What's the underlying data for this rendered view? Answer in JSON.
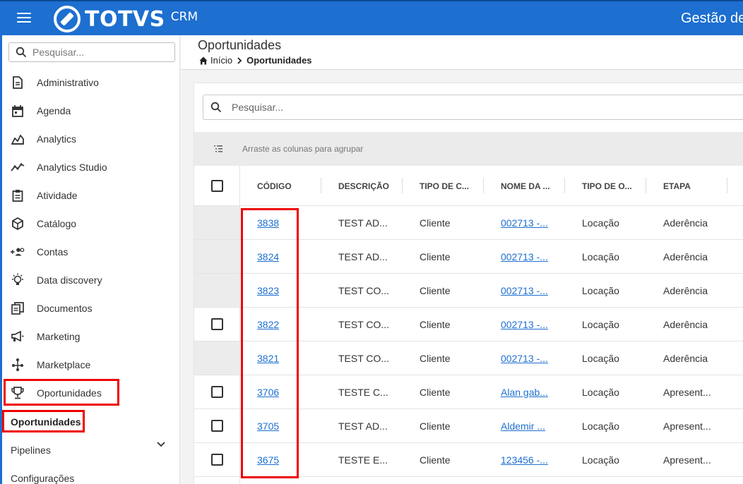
{
  "topbar": {
    "brand": "TOTVS",
    "brand_sub": "CRM",
    "title": "Gestão de"
  },
  "sidebar": {
    "search_placeholder": "Pesquisar...",
    "items": [
      {
        "label": "Administrativo",
        "icon": "document-icon"
      },
      {
        "label": "Agenda",
        "icon": "calendar-icon"
      },
      {
        "label": "Analytics",
        "icon": "area-chart-icon"
      },
      {
        "label": "Analytics Studio",
        "icon": "trend-line-icon"
      },
      {
        "label": "Atividade",
        "icon": "clipboard-icon"
      },
      {
        "label": "Catálogo",
        "icon": "cube-icon"
      },
      {
        "label": "Contas",
        "icon": "people-add-icon"
      },
      {
        "label": "Data discovery",
        "icon": "lightbulb-icon"
      },
      {
        "label": "Documentos",
        "icon": "documents-icon"
      },
      {
        "label": "Marketing",
        "icon": "megaphone-icon"
      },
      {
        "label": "Marketplace",
        "icon": "network-icon"
      },
      {
        "label": "Oportunidades",
        "icon": "trophy-icon"
      }
    ],
    "sub_items": [
      {
        "label": "Oportunidades",
        "active": true
      },
      {
        "label": "Pipelines",
        "active": false
      },
      {
        "label": "Configurações",
        "active": false
      }
    ]
  },
  "header": {
    "page_title": "Oportunidades",
    "breadcrumb": [
      "Início",
      "Oportunidades"
    ]
  },
  "grid": {
    "search_placeholder": "Pesquisar...",
    "group_hint": "Arraste as colunas para agrupar",
    "columns": [
      "CÓDIGO",
      "DESCRIÇÃO",
      "TIPO DE C...",
      "NOME DA ...",
      "TIPO DE O...",
      "ETAPA"
    ],
    "rows": [
      {
        "codigo": "3838",
        "descricao": "TEST AD...",
        "tipo_cliente": "Cliente",
        "nome": "002713 -...",
        "tipo_op": "Locação",
        "etapa": "Aderência",
        "checkbox_visible": false
      },
      {
        "codigo": "3824",
        "descricao": "TEST AD...",
        "tipo_cliente": "Cliente",
        "nome": "002713 -...",
        "tipo_op": "Locação",
        "etapa": "Aderência",
        "checkbox_visible": false
      },
      {
        "codigo": "3823",
        "descricao": "TEST CO...",
        "tipo_cliente": "Cliente",
        "nome": "002713 -...",
        "tipo_op": "Locação",
        "etapa": "Aderência",
        "checkbox_visible": false
      },
      {
        "codigo": "3822",
        "descricao": "TEST CO...",
        "tipo_cliente": "Cliente",
        "nome": "002713 -...",
        "tipo_op": "Locação",
        "etapa": "Aderência",
        "checkbox_visible": true
      },
      {
        "codigo": "3821",
        "descricao": "TEST CO...",
        "tipo_cliente": "Cliente",
        "nome": "002713 -...",
        "tipo_op": "Locação",
        "etapa": "Aderência",
        "checkbox_visible": false
      },
      {
        "codigo": "3706",
        "descricao": "TESTE C...",
        "tipo_cliente": "Cliente",
        "nome": "Alan gab...",
        "tipo_op": "Locação",
        "etapa": "Apresent...",
        "checkbox_visible": true
      },
      {
        "codigo": "3705",
        "descricao": "TEST AD...",
        "tipo_cliente": "Cliente",
        "nome": "Aldemir ...",
        "tipo_op": "Locação",
        "etapa": "Apresent...",
        "checkbox_visible": true
      },
      {
        "codigo": "3675",
        "descricao": "TESTE E...",
        "tipo_cliente": "Cliente",
        "nome": "123456 -...",
        "tipo_op": "Locação",
        "etapa": "Apresent...",
        "checkbox_visible": true
      }
    ]
  },
  "colors": {
    "brand_blue": "#1d6fd0",
    "highlight_red": "#ee0000",
    "link": "#1d6fd0"
  }
}
